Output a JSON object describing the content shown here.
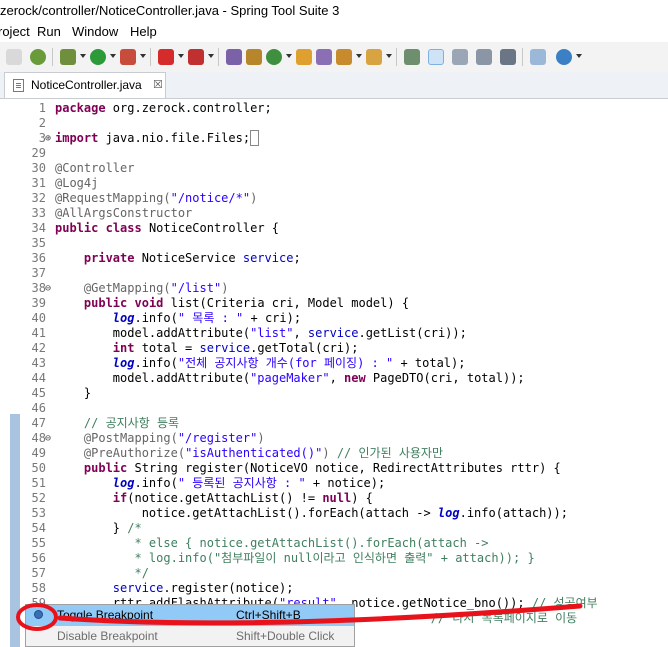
{
  "window": {
    "title": "zerock/controller/NoticeController.java - Spring Tool Suite 3"
  },
  "menu": [
    "roject",
    "Run",
    "Window",
    "Help"
  ],
  "tab": {
    "label": "NoticeController.java",
    "close": "☒"
  },
  "code_lines": [
    {
      "n": "1",
      "fold": "",
      "html": "<span class='kw'>package</span> org.zerock.controller;"
    },
    {
      "n": "2",
      "fold": "",
      "html": ""
    },
    {
      "n": "3",
      "fold": "⊕",
      "html": "<span class='kw'>import</span> java.nio.file.Files;<span style='border:1px solid #888'>&nbsp;</span>"
    },
    {
      "n": "29",
      "fold": "",
      "html": ""
    },
    {
      "n": "30",
      "fold": "",
      "html": "<span class='ann'>@Controller</span>"
    },
    {
      "n": "31",
      "fold": "",
      "html": "<span class='ann'>@Log4j</span>"
    },
    {
      "n": "32",
      "fold": "",
      "html": "<span class='ann'>@RequestMapping(</span><span class='str'>\"/notice/*\"</span><span class='ann'>)</span>"
    },
    {
      "n": "33",
      "fold": "",
      "html": "<span class='ann'>@AllArgsConstructor</span>"
    },
    {
      "n": "34",
      "fold": "",
      "html": "<span class='kw'>public</span> <span class='kw'>class</span> NoticeController {"
    },
    {
      "n": "35",
      "fold": "",
      "html": ""
    },
    {
      "n": "36",
      "fold": "",
      "html": "    <span class='kw'>private</span> NoticeService <span class='field'>service</span>;"
    },
    {
      "n": "37",
      "fold": "",
      "html": ""
    },
    {
      "n": "38",
      "fold": "⊖",
      "html": "    <span class='ann'>@GetMapping(</span><span class='str'>\"/list\"</span><span class='ann'>)</span>"
    },
    {
      "n": "39",
      "fold": "",
      "html": "    <span class='kw'>public</span> <span class='kw'>void</span> list(Criteria cri, Model model) {"
    },
    {
      "n": "40",
      "fold": "",
      "html": "        <span class='stat'>log</span>.info(<span class='str'>\" 목록 : \"</span> + cri);"
    },
    {
      "n": "41",
      "fold": "",
      "html": "        model.addAttribute(<span class='str'>\"list\"</span>, <span class='field'>service</span>.getList(cri));"
    },
    {
      "n": "42",
      "fold": "",
      "html": "        <span class='kw'>int</span> total = <span class='field'>service</span>.getTotal(cri);"
    },
    {
      "n": "43",
      "fold": "",
      "html": "        <span class='stat'>log</span>.info(<span class='str'>\"전체 공지사항 개수(for 페이징) : \"</span> + total);"
    },
    {
      "n": "44",
      "fold": "",
      "html": "        model.addAttribute(<span class='str'>\"pageMaker\"</span>, <span class='kw'>new</span> PageDTO(cri, total));"
    },
    {
      "n": "45",
      "fold": "",
      "html": "    }"
    },
    {
      "n": "46",
      "fold": "",
      "html": ""
    },
    {
      "n": "47",
      "fold": "",
      "html": "    <span class='com'>// 공지사항 등록</span>"
    },
    {
      "n": "48",
      "fold": "⊖",
      "html": "    <span class='ann'>@PostMapping(</span><span class='str'>\"/register\"</span><span class='ann'>)</span>"
    },
    {
      "n": "49",
      "fold": "",
      "html": "    <span class='ann'>@PreAuthorize(</span><span class='str'>\"isAuthenticated()\"</span><span class='ann'>)</span> <span class='com'>// 인가된 사용자만</span>"
    },
    {
      "n": "50",
      "fold": "",
      "html": "    <span class='kw'>public</span> String register(NoticeVO notice, RedirectAttributes rttr) {"
    },
    {
      "n": "51",
      "fold": "",
      "html": "        <span class='stat'>log</span>.info(<span class='str'>\" 등록된 공지사항 : \"</span> + notice);"
    },
    {
      "n": "52",
      "fold": "",
      "html": "        <span class='kw'>if</span>(notice.getAttachList() != <span class='kw'>null</span>) {"
    },
    {
      "n": "53",
      "fold": "",
      "html": "            notice.getAttachList().forEach(attach -&gt; <span class='stat'>log</span>.info(attach));"
    },
    {
      "n": "54",
      "fold": "",
      "html": "        } <span class='com'>/*</span>"
    },
    {
      "n": "55",
      "fold": "",
      "html": "<span class='com'>           * else { notice.getAttachList().forEach(attach -&gt;</span>"
    },
    {
      "n": "56",
      "fold": "",
      "html": "<span class='com'>           * log.info(\"첨부파일이 null이라고 인식하면 출력\" + attach)); }</span>"
    },
    {
      "n": "57",
      "fold": "",
      "html": "<span class='com'>           */</span>"
    },
    {
      "n": "58",
      "fold": "",
      "html": "        <span class='field'>service</span>.register(notice);"
    },
    {
      "n": "59",
      "fold": "",
      "html": "        rttr.addFlashAttribute(<span class='str'>\"result\"</span>, notice.getNotice_bno()); <span class='com'>// 성공여부</span>"
    },
    {
      "n": "60",
      "fold": "",
      "html": "                                                    <span class='com'>// 다시 목록페이지로 이동</span>"
    }
  ],
  "context_menu": {
    "items": [
      {
        "label": "Toggle Breakpoint",
        "accel": "Ctrl+Shift+B"
      },
      {
        "label": "Disable Breakpoint",
        "accel": "Shift+Double Click"
      }
    ]
  },
  "colors": {
    "selection": "#91c9f7",
    "annotation_stroke": "#e8121b"
  }
}
